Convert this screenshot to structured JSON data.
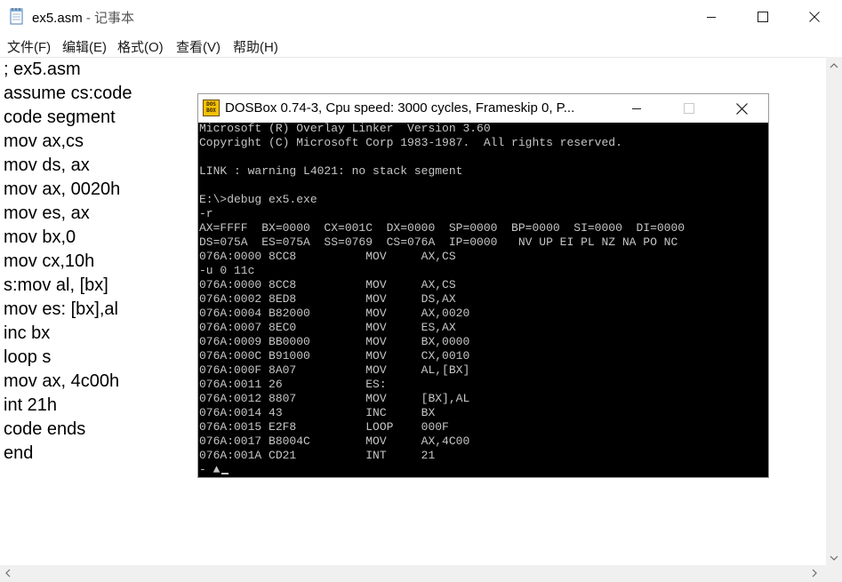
{
  "notepad": {
    "title": "ex5.asm",
    "title_suffix": " - 记事本",
    "menu": [
      "文件(F)",
      "编辑(E)",
      "格式(O)",
      "查看(V)",
      "帮助(H)"
    ],
    "lines": [
      "; ex5.asm",
      "assume cs:code",
      "code segment",
      "mov ax,cs",
      "mov ds, ax",
      "mov ax, 0020h",
      "mov es, ax",
      "mov bx,0",
      "mov cx,10h",
      "s:mov al, [bx]",
      "mov es: [bx],al",
      "inc bx",
      "loop s",
      "mov ax, 4c00h",
      "int 21h",
      "code ends",
      "end"
    ]
  },
  "dosbox": {
    "title": "DOSBox 0.74-3, Cpu speed:     3000 cycles, Frameskip  0, P...",
    "logo_text": [
      "DOS",
      "BOX"
    ],
    "lines": [
      "Microsoft (R) Overlay Linker  Version 3.60",
      "Copyright (C) Microsoft Corp 1983-1987.  All rights reserved.",
      "",
      "LINK : warning L4021: no stack segment",
      "",
      "E:\\>debug ex5.exe",
      "-r",
      "AX=FFFF  BX=0000  CX=001C  DX=0000  SP=0000  BP=0000  SI=0000  DI=0000",
      "DS=075A  ES=075A  SS=0769  CS=076A  IP=0000   NV UP EI PL NZ NA PO NC",
      "076A:0000 8CC8          MOV     AX,CS",
      "-u 0 11c",
      "076A:0000 8CC8          MOV     AX,CS",
      "076A:0002 8ED8          MOV     DS,AX",
      "076A:0004 B82000        MOV     AX,0020",
      "076A:0007 8EC0          MOV     ES,AX",
      "076A:0009 BB0000        MOV     BX,0000",
      "076A:000C B91000        MOV     CX,0010",
      "076A:000F 8A07          MOV     AL,[BX]",
      "076A:0011 26            ES:",
      "076A:0012 8807          MOV     [BX],AL",
      "076A:0014 43            INC     BX",
      "076A:0015 E2F8          LOOP    000F",
      "076A:0017 B8004C        MOV     AX,4C00",
      "076A:001A CD21          INT     21"
    ],
    "prompt": "- ▲"
  },
  "icons": {
    "notepad": "notepad-icon",
    "minimize": "minimize-icon",
    "maximize": "maximize-icon",
    "close": "close-icon"
  },
  "colors": {
    "dos_bg": "#000000",
    "dos_text": "#c6c6c6",
    "dos_logo": "#f2c200"
  }
}
